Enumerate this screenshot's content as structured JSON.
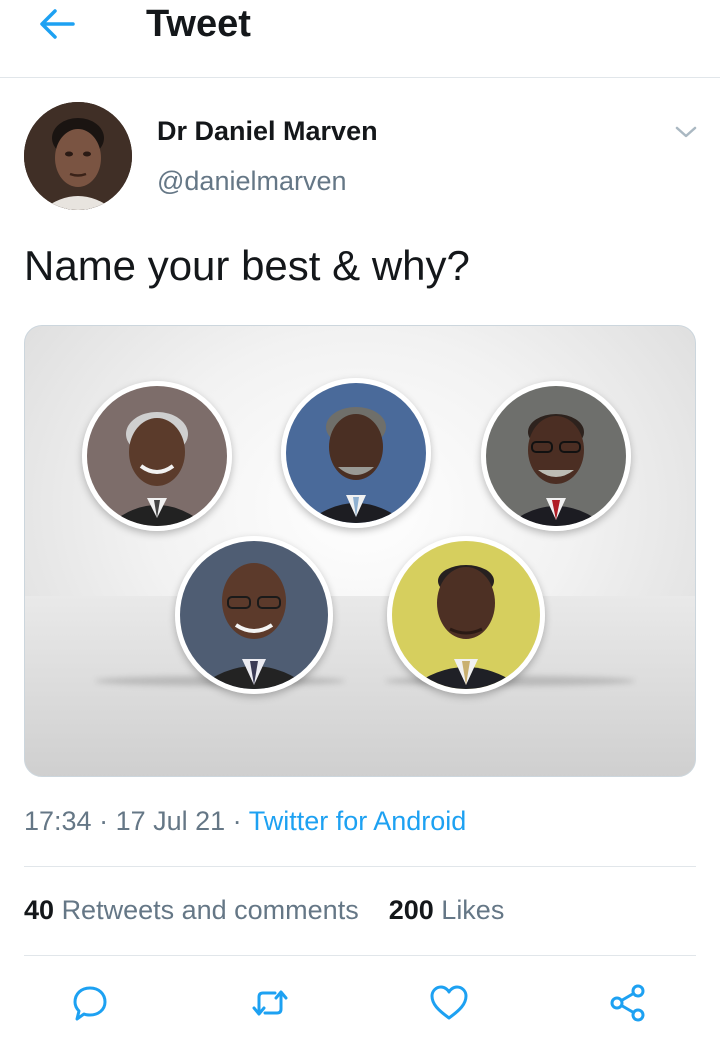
{
  "header": {
    "title": "Tweet",
    "back_icon": "arrow-left-icon",
    "accent_color": "#1da1f2"
  },
  "author": {
    "name": "Dr Daniel Marven",
    "handle": "@danielmarven"
  },
  "tweet": {
    "text": "Name your best & why?",
    "time": "17:34",
    "sep1": " · ",
    "date": "17 Jul 21",
    "sep2": " · ",
    "source": "Twitter for Android"
  },
  "stats": {
    "retweets_count": "40",
    "retweets_label": "Retweets and comments",
    "likes_count": "200",
    "likes_label": "Likes"
  },
  "actions": [
    "reply-icon",
    "retweet-icon",
    "like-icon",
    "share-icon"
  ]
}
